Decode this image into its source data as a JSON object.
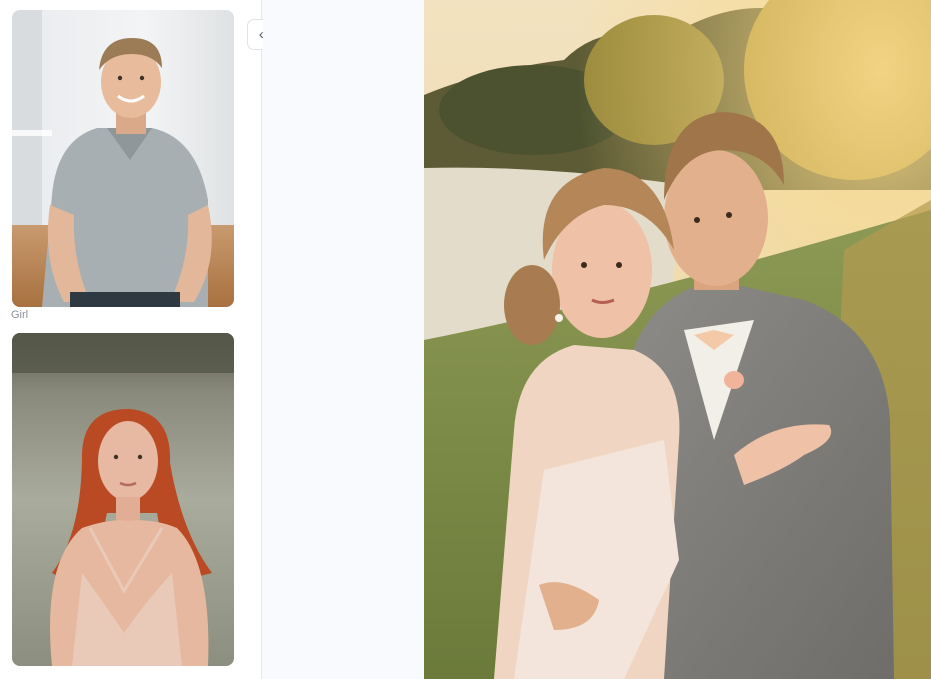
{
  "sidebar": {
    "top_label": "",
    "references": [
      {
        "name": "man-reference",
        "label": ""
      },
      {
        "name": "girl-reference",
        "label": "Girl"
      }
    ]
  },
  "toolbar": {
    "collapse_icon": "double-chevron-left-icon"
  },
  "result": {
    "description_icon": "generated-image"
  },
  "colors": {
    "sidebar_bg": "#ffffff",
    "panel_bg": "#f8fafd",
    "label": "#8a9099"
  }
}
